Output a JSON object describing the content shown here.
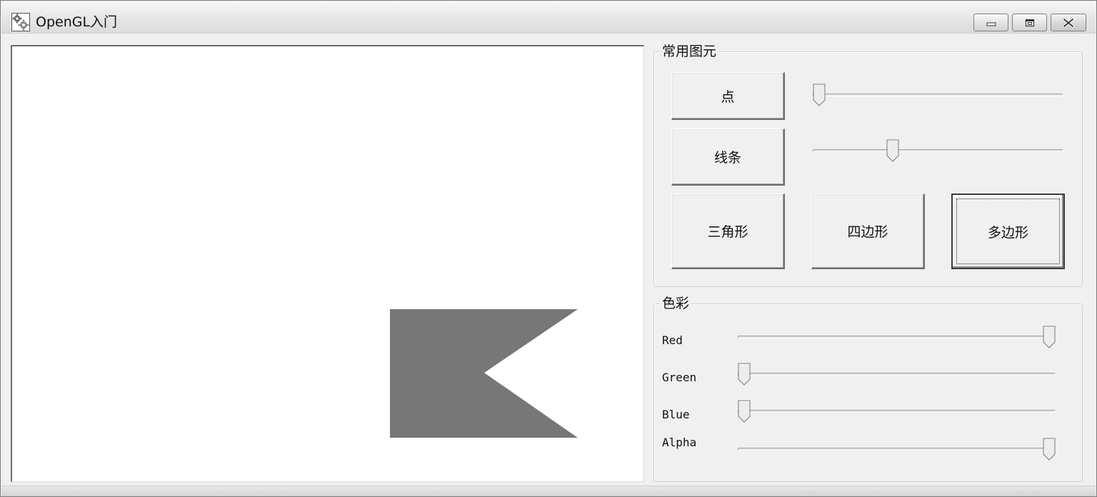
{
  "window": {
    "title": "OpenGL入门",
    "icon": "app-gear-icon"
  },
  "primitives_group": {
    "title": "常用图元",
    "buttons": {
      "point": "点",
      "line": "线条",
      "triangle": "三角形",
      "quad": "四边形",
      "polygon": "多边形"
    },
    "point_size_slider": {
      "value": 0.0
    },
    "line_width_slider": {
      "value": 0.31
    }
  },
  "color_group": {
    "title": "色彩",
    "channels": [
      {
        "label": "Red",
        "value": 1.0
      },
      {
        "label": "Green",
        "value": 0.0
      },
      {
        "label": "Blue",
        "value": 0.0
      },
      {
        "label": "Alpha",
        "value": 1.0
      }
    ]
  },
  "canvas": {
    "shape": "polygon",
    "fill_color": "#777777",
    "background": "#ffffff"
  },
  "colors": {
    "window_bg": "#f0f0f0",
    "frame_border": "#7c7c7c"
  }
}
